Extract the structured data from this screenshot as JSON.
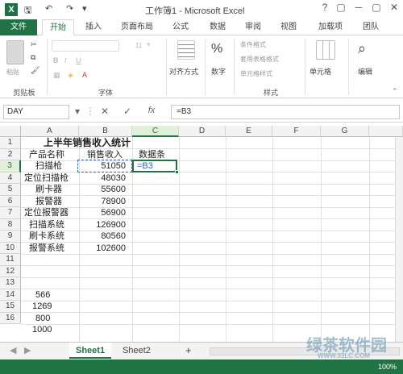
{
  "window": {
    "title": "工作簿1 - Microsoft Excel",
    "controls": [
      "?",
      "▢",
      "─",
      "▢",
      "✕"
    ]
  },
  "tabs": {
    "file": "文件",
    "items": [
      "开始",
      "插入",
      "页面布局",
      "公式",
      "数据",
      "审阅",
      "视图",
      "加载项",
      "团队"
    ]
  },
  "ribbon": {
    "clipboard_label": "剪贴板",
    "font_label": "字体",
    "font_size": "11",
    "align_label": "对齐方式",
    "number_label": "数字",
    "number_format": "%",
    "conditional_format": "条件格式",
    "table_format": "套用表格格式",
    "cell_style": "单元格样式",
    "styles_label": "样式",
    "cells_label": "单元格",
    "edit_label": "编辑"
  },
  "formula_bar": {
    "name_box": "DAY",
    "formula": "=B3",
    "cancel_icon": "✕",
    "enter_icon": "✓",
    "fx_icon": "fx"
  },
  "grid": {
    "columns": [
      "A",
      "B",
      "C",
      "D",
      "E",
      "F",
      "G"
    ],
    "rows": [
      "1",
      "2",
      "3",
      "4",
      "5",
      "6",
      "7",
      "8",
      "9",
      "10",
      "11",
      "12",
      "13",
      "14",
      "15",
      "16"
    ],
    "title": "上半年销售收入统计",
    "header_a": "产品名称",
    "header_b": "销售收入",
    "header_c": "数据条",
    "products": [
      "扫描枪",
      "定位扫描枪",
      "刷卡器",
      "报警器",
      "定位报警器",
      "扫描系统",
      "刷卡系统",
      "报警系统"
    ],
    "revenue": [
      "51050",
      "48030",
      "55600",
      "78900",
      "56900",
      "126900",
      "80560",
      "102600"
    ],
    "editing_cell": "=B3",
    "lower_values": [
      "566",
      "1269",
      "800",
      "1000"
    ]
  },
  "sheets": {
    "tabs": [
      "Sheet1",
      "Sheet2"
    ],
    "add_icon": "+"
  },
  "status": {
    "zoom": "100%"
  },
  "watermark": {
    "line1": "绿茶软件园",
    "line2": "WWW.33LC.COM"
  }
}
